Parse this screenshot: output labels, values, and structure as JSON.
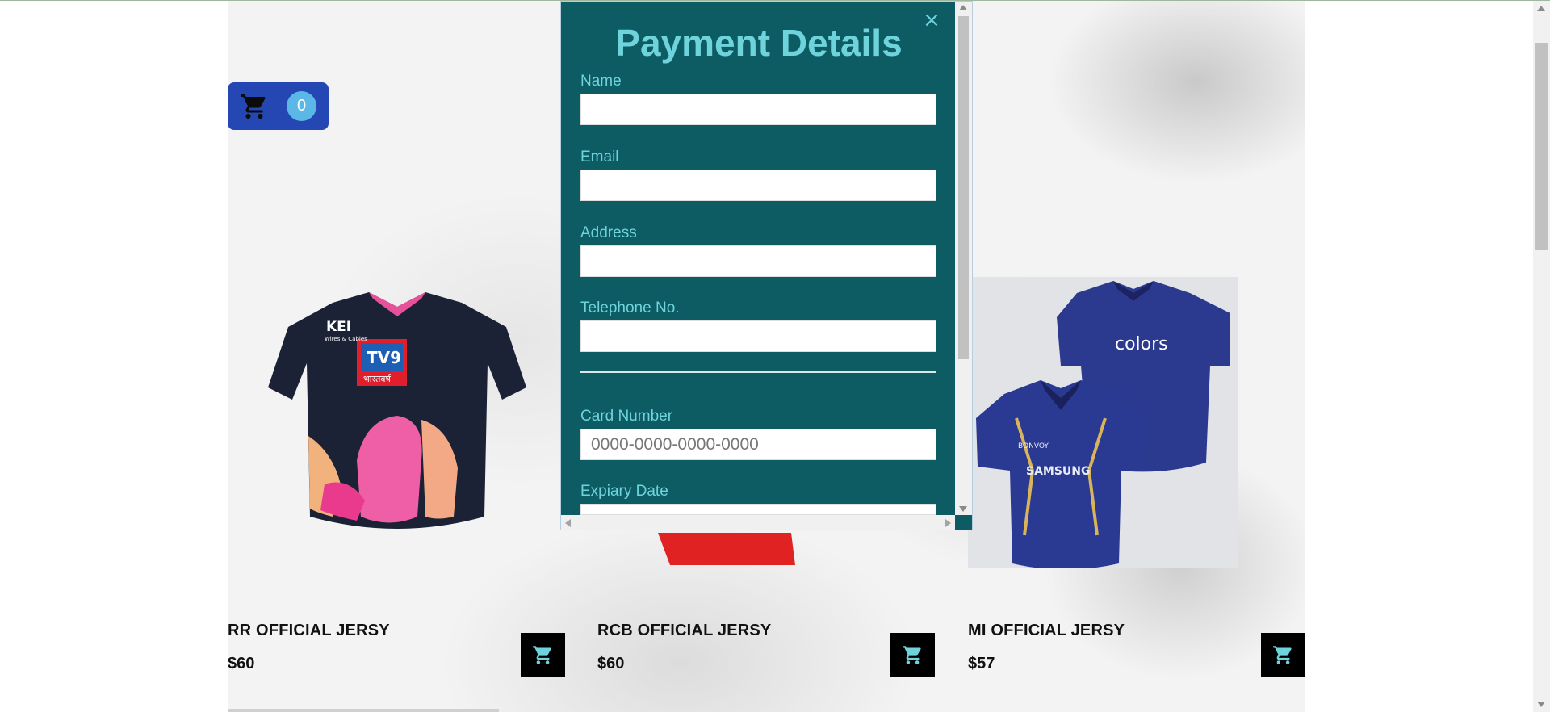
{
  "cart": {
    "count": "0"
  },
  "products": [
    {
      "name": "RR OFFICIAL JERSY",
      "price": "$60"
    },
    {
      "name": "RCB OFFICIAL JERSY",
      "price": "$60"
    },
    {
      "name": "MI OFFICIAL JERSY",
      "price": "$57"
    }
  ],
  "jersey_text": {
    "rr_brand": "KEI",
    "rr_sub": "Wires & Cables",
    "rr_sponsor": "TV9",
    "rr_hindi": "भारतवर्ष",
    "mi_colors": "colors",
    "mi_samsung": "SAMSUNG",
    "mi_bonvoy": "BONVOY"
  },
  "modal": {
    "title": "Payment Details",
    "close_symbol": "×",
    "fields": {
      "name_label": "Name",
      "email_label": "Email",
      "address_label": "Address",
      "telephone_label": "Telephone No.",
      "card_number_label": "Card Number",
      "card_number_placeholder": "0000-0000-0000-0000",
      "expiry_label": "Expiary Date"
    }
  },
  "colors": {
    "modal_bg": "#0d5c63",
    "accent": "#6fd3dc",
    "cart_bg": "#2447b3",
    "cart_badge": "#5ab7e6",
    "add_button_bg": "#000000"
  },
  "icons": [
    "cart-icon",
    "close-icon",
    "add-to-cart-icon"
  ]
}
